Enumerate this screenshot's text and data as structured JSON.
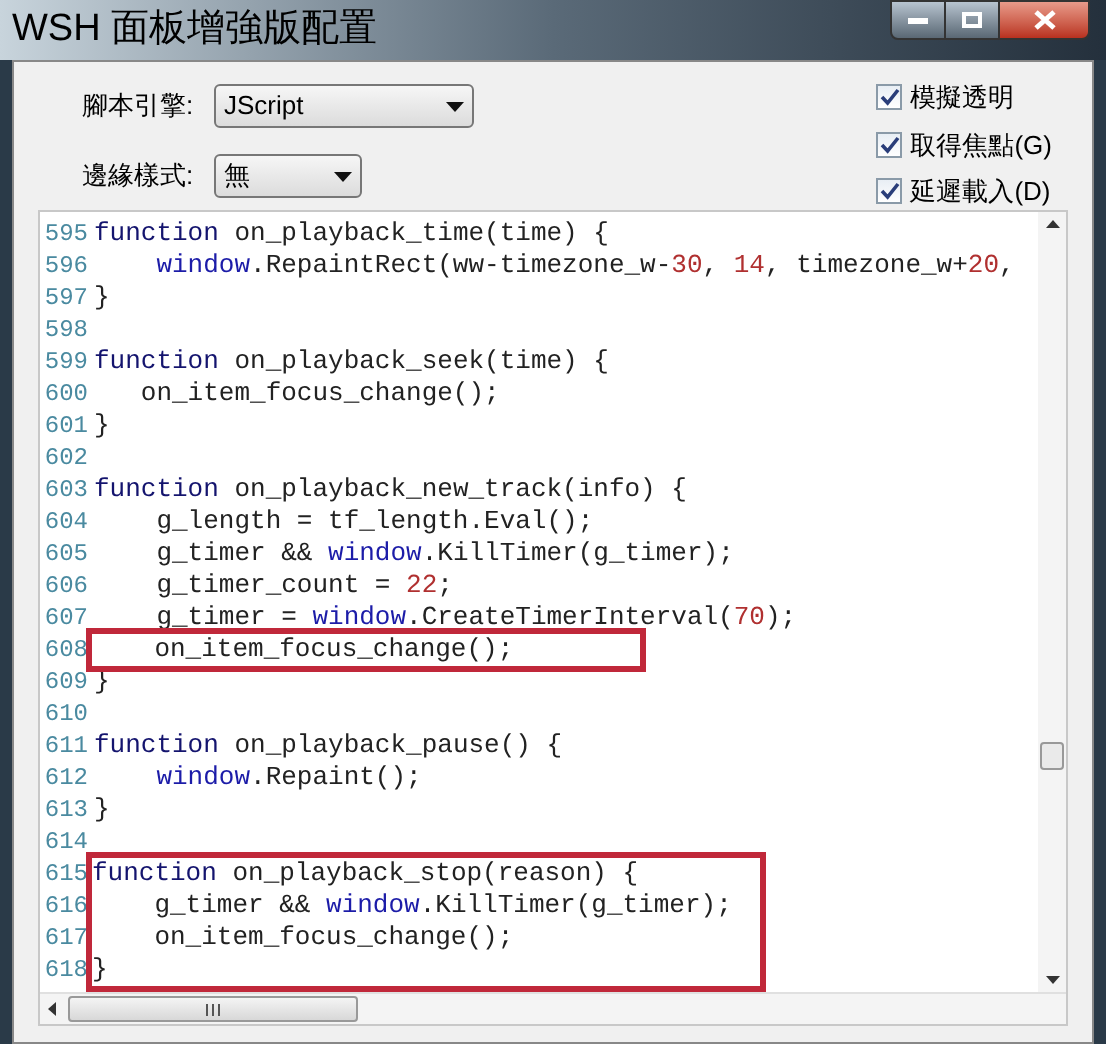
{
  "window": {
    "title": "WSH 面板增強版配置"
  },
  "settings": [
    {
      "label": "腳本引擎:",
      "value": "JScript"
    },
    {
      "label": "邊緣樣式:",
      "value": "無"
    }
  ],
  "options": [
    {
      "label": "模擬透明",
      "checked": true
    },
    {
      "label": "取得焦點(G)",
      "checked": true
    },
    {
      "label": "延遲載入(D)",
      "checked": true
    }
  ],
  "editor": {
    "lines": [
      {
        "number": "595",
        "boxed": false,
        "tokens": [
          {
            "kind": "keyword",
            "text": "function"
          },
          {
            "kind": "plain",
            "text": " on_playback_time(time) {"
          }
        ]
      },
      {
        "number": "596",
        "boxed": false,
        "tokens": [
          {
            "kind": "object",
            "text": "    window"
          },
          {
            "kind": "plain",
            "text": ".RepaintRect(ww-timezone_w-"
          },
          {
            "kind": "number",
            "text": "30"
          },
          {
            "kind": "plain",
            "text": ", "
          },
          {
            "kind": "number",
            "text": "14"
          },
          {
            "kind": "plain",
            "text": ", timezone_w+"
          },
          {
            "kind": "number",
            "text": "20"
          },
          {
            "kind": "plain",
            "text": ","
          }
        ]
      },
      {
        "number": "597",
        "boxed": false,
        "tokens": [
          {
            "kind": "plain",
            "text": "}"
          }
        ]
      },
      {
        "number": "598",
        "boxed": false
      },
      {
        "number": "599",
        "boxed": false,
        "tokens": [
          {
            "kind": "keyword",
            "text": "function"
          },
          {
            "kind": "plain",
            "text": " on_playback_seek(time) {"
          }
        ]
      },
      {
        "number": "600",
        "boxed": false,
        "tokens": [
          {
            "kind": "plain",
            "text": "   on_item_focus_change();"
          }
        ]
      },
      {
        "number": "601",
        "boxed": false,
        "tokens": [
          {
            "kind": "plain",
            "text": "}"
          }
        ]
      },
      {
        "number": "602",
        "boxed": false
      },
      {
        "number": "603",
        "boxed": false,
        "tokens": [
          {
            "kind": "keyword",
            "text": "function"
          },
          {
            "kind": "plain",
            "text": " on_playback_new_track(info) {"
          }
        ]
      },
      {
        "number": "604",
        "boxed": false,
        "tokens": [
          {
            "kind": "plain",
            "text": "    g_length = tf_length.Eval();"
          }
        ]
      },
      {
        "number": "605",
        "boxed": false,
        "tokens": [
          {
            "kind": "plain",
            "text": "    g_timer && "
          },
          {
            "kind": "object",
            "text": "window"
          },
          {
            "kind": "plain",
            "text": ".KillTimer(g_timer);"
          }
        ]
      },
      {
        "number": "606",
        "boxed": false,
        "tokens": [
          {
            "kind": "plain",
            "text": "    g_timer_count = "
          },
          {
            "kind": "number",
            "text": "22"
          },
          {
            "kind": "plain",
            "text": ";"
          }
        ]
      },
      {
        "number": "607",
        "boxed": false,
        "tokens": [
          {
            "kind": "plain",
            "text": "    g_timer = "
          },
          {
            "kind": "object",
            "text": "window"
          },
          {
            "kind": "plain",
            "text": ".CreateTimerInterval("
          },
          {
            "kind": "number",
            "text": "70"
          },
          {
            "kind": "plain",
            "text": ");"
          }
        ]
      },
      {
        "number": "608",
        "boxed": true,
        "tokens": [
          {
            "kind": "plain",
            "text": "    on_item_focus_change();"
          }
        ]
      },
      {
        "number": "609",
        "boxed": false,
        "tokens": [
          {
            "kind": "plain",
            "text": "}"
          }
        ]
      },
      {
        "number": "610",
        "boxed": false
      },
      {
        "number": "611",
        "boxed": false,
        "tokens": [
          {
            "kind": "keyword",
            "text": "function"
          },
          {
            "kind": "plain",
            "text": " on_playback_pause() {"
          }
        ]
      },
      {
        "number": "612",
        "boxed": false,
        "tokens": [
          {
            "kind": "object",
            "text": "    window"
          },
          {
            "kind": "plain",
            "text": ".Repaint();"
          }
        ]
      },
      {
        "number": "613",
        "boxed": false,
        "tokens": [
          {
            "kind": "plain",
            "text": "}"
          }
        ]
      },
      {
        "number": "614",
        "boxed": false
      },
      {
        "number": "615",
        "boxed": true,
        "tokens": [
          {
            "kind": "keyword",
            "text": "function"
          },
          {
            "kind": "plain",
            "text": " on_playback_stop(reason) {"
          }
        ]
      },
      {
        "number": "616",
        "boxed": true,
        "tokens": [
          {
            "kind": "plain",
            "text": "    g_timer && "
          },
          {
            "kind": "object",
            "text": "window"
          },
          {
            "kind": "plain",
            "text": ".KillTimer(g_timer);"
          }
        ]
      },
      {
        "number": "617",
        "boxed": true,
        "tokens": [
          {
            "kind": "plain",
            "text": "    on_item_focus_change();"
          }
        ]
      },
      {
        "number": "618",
        "boxed": true,
        "tokens": [
          {
            "kind": "plain",
            "text": "}"
          }
        ]
      }
    ]
  }
}
